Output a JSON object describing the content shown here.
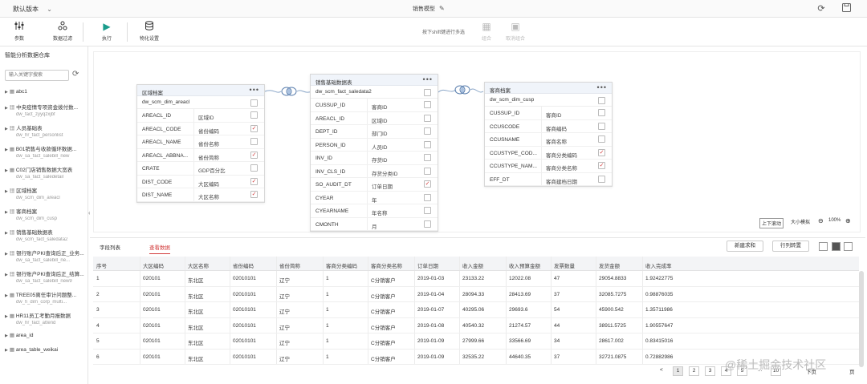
{
  "titlebar": {
    "version": "默认版本",
    "title": "销售模型",
    "icons": {
      "chevron": "chevron-down-icon",
      "edit": "pencil-icon",
      "refresh": "refresh-icon",
      "save": "save-icon"
    }
  },
  "toolbar": {
    "tools": [
      {
        "label": "参数",
        "icon": "sliders-icon"
      },
      {
        "label": "数据过滤",
        "icon": "filter-icon"
      },
      {
        "label": "执行",
        "icon": "play-icon"
      },
      {
        "label": "物化设置",
        "icon": "database-icon"
      }
    ],
    "hint": "按下shift键进行多选",
    "right_tools": [
      {
        "label": "组合",
        "icon": "combine-icon"
      },
      {
        "label": "取消组合",
        "icon": "ungroup-icon"
      }
    ]
  },
  "sidebar": {
    "title": "智能分析数据仓库",
    "search_placeholder": "输入关键字搜索",
    "items": [
      {
        "name": "abc1",
        "sub": ""
      },
      {
        "name": "中央疫情专项资金拨付数...",
        "sub": "dw_fact_zyyqzxjbf"
      },
      {
        "name": "人员基础表",
        "sub": "dw_hr_fact_personlist"
      },
      {
        "name": "B01销售与收款循环数据...",
        "sub": "dw_sa_fact_salebill_new"
      },
      {
        "name": "C02门店销售数据大宽表",
        "sub": "dw_sa_fact_saledetail"
      },
      {
        "name": "区域档案",
        "sub": "dw_scm_dim_areacl"
      },
      {
        "name": "客商档案",
        "sub": "dw_scm_dim_cusp"
      },
      {
        "name": "销售基础数据表",
        "sub": "dw_scm_fact_saledata2"
      },
      {
        "name": "银行账户PKI查询后正_业务...",
        "sub": "dw_sa_fact_salebill_ne..."
      },
      {
        "name": "银行账户PKI查询后正_结算...",
        "sub": "dw_sa_fact_salebill_new9"
      },
      {
        "name": "TREE05离任审计问题整...",
        "sub": "dw_fi_dim_corp_multi..."
      },
      {
        "name": "HR11员工考勤月报数据",
        "sub": "dw_hr_fact_attend"
      },
      {
        "name": "area_id",
        "sub": ""
      },
      {
        "name": "area_table_weikai",
        "sub": ""
      }
    ]
  },
  "tables": [
    {
      "header": "区域档案",
      "subtitle": "dw_scm_dim_areacl",
      "rows": [
        {
          "field": "AREACL_ID",
          "label": "区域ID",
          "checked": false
        },
        {
          "field": "AREACL_CODE",
          "label": "省份编码",
          "checked": true
        },
        {
          "field": "AREACL_NAME",
          "label": "省份名称",
          "checked": false
        },
        {
          "field": "AREACL_ABBNA...",
          "label": "省份简称",
          "checked": true
        },
        {
          "field": "CRATE",
          "label": "GDP百分比",
          "checked": false
        },
        {
          "field": "DIST_CODE",
          "label": "大区编码",
          "checked": true
        },
        {
          "field": "DIST_NAME",
          "label": "大区名称",
          "checked": true
        }
      ]
    },
    {
      "header": "销售基础数据表",
      "subtitle": "dw_scm_fact_saledata2",
      "rows": [
        {
          "field": "CUSSUP_ID",
          "label": "客商ID",
          "checked": false
        },
        {
          "field": "AREACL_ID",
          "label": "区域ID",
          "checked": false
        },
        {
          "field": "DEPT_ID",
          "label": "部门ID",
          "checked": false
        },
        {
          "field": "PERSON_ID",
          "label": "人员ID",
          "checked": false
        },
        {
          "field": "INV_ID",
          "label": "存货ID",
          "checked": false
        },
        {
          "field": "INV_CLS_ID",
          "label": "存货分类ID",
          "checked": false
        },
        {
          "field": "SO_AUDIT_DT",
          "label": "订单日期",
          "checked": true
        },
        {
          "field": "CYEAR",
          "label": "年",
          "checked": false
        },
        {
          "field": "CYEARNAME",
          "label": "年名称",
          "checked": false
        },
        {
          "field": "CMONTH",
          "label": "月",
          "checked": false
        }
      ]
    },
    {
      "header": "客商档案",
      "subtitle": "dw_scm_dim_cusp",
      "rows": [
        {
          "field": "CUSSUP_ID",
          "label": "客商ID",
          "checked": false
        },
        {
          "field": "CCUSCODE",
          "label": "客商编码",
          "checked": false
        },
        {
          "field": "CCUSNAME",
          "label": "客商名称",
          "checked": false
        },
        {
          "field": "CCUSTYPE_COD...",
          "label": "客商分类编码",
          "checked": true
        },
        {
          "field": "CCUSTYPE_NAM...",
          "label": "客商分类名称",
          "checked": true
        },
        {
          "field": "EFF_DT",
          "label": "客商建档日期",
          "checked": false
        }
      ]
    }
  ],
  "canvas": {
    "zoom_fit": "上下滚动",
    "zoom_label": "大小模拟",
    "zoom_value": "100%"
  },
  "bottom": {
    "tabs": [
      "字段列表",
      "查看数据"
    ],
    "active_tab": 1,
    "buttons": {
      "new_calc": "新建求和",
      "row_col": "行列转置"
    },
    "columns": [
      "序号",
      "大区编码",
      "大区名称",
      "省份编码",
      "省份简称",
      "客商分类编码",
      "客商分类名称",
      "订单日期",
      "收入金额",
      "收入预算金额",
      "发票数量",
      "发货金额",
      "收入完成率"
    ],
    "rows": [
      [
        "1",
        "020101",
        "东北区",
        "02010101",
        "辽宁",
        "1",
        "C分销客户",
        "2019-01-03",
        "23133.22",
        "12022.08",
        "47",
        "29054.8833",
        "1.92422775"
      ],
      [
        "2",
        "020101",
        "东北区",
        "02010101",
        "辽宁",
        "1",
        "C分销客户",
        "2019-01-04",
        "28094.33",
        "28413.69",
        "37",
        "32085.7275",
        "0.98876035"
      ],
      [
        "3",
        "020101",
        "东北区",
        "02010101",
        "辽宁",
        "1",
        "C分销客户",
        "2019-01-07",
        "40295.06",
        "29693.6",
        "54",
        "45900.542",
        "1.35711986"
      ],
      [
        "4",
        "020101",
        "东北区",
        "02010101",
        "辽宁",
        "1",
        "C分销客户",
        "2019-01-08",
        "40540.32",
        "21274.57",
        "44",
        "38911.5725",
        "1.90557647"
      ],
      [
        "5",
        "020101",
        "东北区",
        "02010101",
        "辽宁",
        "1",
        "C分销客户",
        "2019-01-09",
        "27999.66",
        "33566.69",
        "34",
        "28617.002",
        "0.83415016"
      ],
      [
        "6",
        "020101",
        "东北区",
        "02010101",
        "辽宁",
        "1",
        "C分销客户",
        "2019-01-09",
        "32535.22",
        "44640.35",
        "37",
        "32721.0875",
        "0.72882986"
      ]
    ]
  },
  "pager": {
    "prev": "<",
    "pages": [
      "1",
      "2",
      "3",
      "4",
      "5",
      "...",
      "10"
    ],
    "next": "下页",
    "extra": "页"
  },
  "watermark": "@稀土掘金技术社区"
}
